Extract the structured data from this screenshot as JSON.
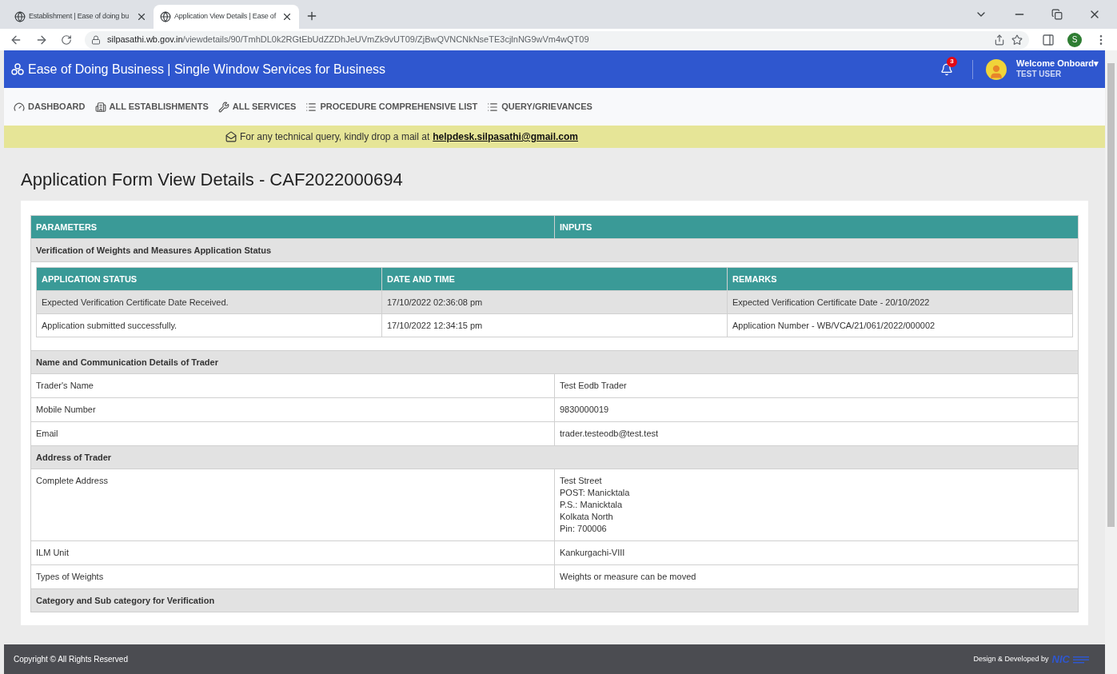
{
  "browser": {
    "tabs": [
      {
        "title": "Establishment | Ease of doing bu",
        "selected": false
      },
      {
        "title": "Application View Details | Ease of",
        "selected": true
      }
    ],
    "url_host": "silpasathi.wb.gov.in",
    "url_path": "/viewdetails/90/TmhDL0k2RGtEbUdZZDhJeUVmZk9vUT09/ZjBwQVNCNkNseTE3cjlnNG9wVm4wQT09",
    "profile_initial": "S"
  },
  "header": {
    "title": "Ease of Doing Business | Single Window Services for Business",
    "notification_count": "3",
    "welcome": "Welcome Onboard",
    "welcome_caret": "▾",
    "user": "TEST USER"
  },
  "nav": [
    {
      "label": "DASHBOARD",
      "kind": "gauge"
    },
    {
      "label": "ALL ESTABLISHMENTS",
      "kind": "building"
    },
    {
      "label": "ALL SERVICES",
      "kind": "wrench"
    },
    {
      "label": "PROCEDURE COMPREHENSIVE LIST",
      "kind": "list"
    },
    {
      "label": "QUERY/GRIEVANCES",
      "kind": "list"
    }
  ],
  "banner": {
    "text": "For any technical query, kindly drop a mail at",
    "link": "helpdesk.silpasathi@gmail.com"
  },
  "page_title": "Application Form View Details - CAF2022000694",
  "table": {
    "columns": [
      "PARAMETERS",
      "INPUTS"
    ],
    "sections": [
      {
        "kind": "status",
        "title": "Verification of Weights and Measures Application Status",
        "columns": [
          "APPLICATION STATUS",
          "DATE AND TIME",
          "REMARKS"
        ],
        "rows": [
          [
            "Expected Verification Certificate Date Received.",
            "17/10/2022 02:36:08 pm",
            "Expected Verification Certificate Date - 20/10/2022"
          ],
          [
            "Application submitted successfully.",
            "17/10/2022 12:34:15 pm",
            "Application Number - WB/VCA/21/061/2022/000002"
          ]
        ]
      },
      {
        "kind": "fields",
        "title": "Name and Communication Details of Trader",
        "rows": [
          {
            "label": "Trader's Name",
            "value": [
              "Test Eodb Trader"
            ]
          },
          {
            "label": "Mobile Number",
            "value": [
              "9830000019"
            ]
          },
          {
            "label": "Email",
            "value": [
              "trader.testeodb@test.test"
            ]
          }
        ]
      },
      {
        "kind": "fields",
        "title": "Address of Trader",
        "rows": [
          {
            "label": "Complete Address",
            "value": [
              "Test Street",
              "POST: Manicktala",
              "P.S.: Manicktala",
              "Kolkata North",
              "Pin: 700006"
            ]
          },
          {
            "label": "ILM Unit",
            "value": [
              "Kankurgachi-VIII"
            ]
          },
          {
            "label": "Types of Weights",
            "value": [
              "Weights or measure can be moved"
            ]
          }
        ]
      },
      {
        "kind": "fields",
        "title": "Category and Sub category for Verification"
      }
    ]
  },
  "footer": {
    "copyright": "Copyright © All Rights Reserved",
    "credit": "Design & Developed by",
    "logo": "NIC"
  }
}
